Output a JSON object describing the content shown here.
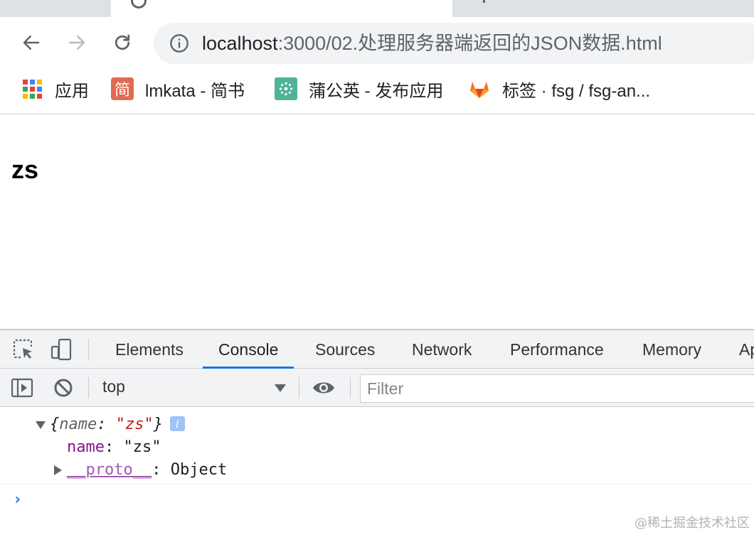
{
  "browser": {
    "address": {
      "host": "localhost",
      "path": ":3000/02.处理服务器端返回的JSON数据.html"
    },
    "bookmarks": [
      {
        "label": "应用",
        "icon": "apps-grid-icon"
      },
      {
        "label": "lmkata - 简书",
        "icon": "jianshu-icon",
        "icon_text": "简"
      },
      {
        "label": "蒲公英 - 发布应用",
        "icon": "pugongying-icon"
      },
      {
        "label": "标签 · fsg / fsg-an...",
        "icon": "gitlab-icon"
      }
    ]
  },
  "page": {
    "heading": "zs"
  },
  "devtools": {
    "tabs": [
      "Elements",
      "Console",
      "Sources",
      "Network",
      "Performance",
      "Memory",
      "Ap"
    ],
    "active_tab": "Console",
    "context": "top",
    "filter_placeholder": "Filter",
    "console": {
      "object_open": "{",
      "object_key": "name",
      "object_sep": ": ",
      "object_value": "\"zs\"",
      "object_close": "}",
      "prop_key": "name",
      "prop_sep": ": ",
      "prop_value": "\"zs\"",
      "proto_key": "__proto__",
      "proto_sep": ": ",
      "proto_value": "Object",
      "info_badge": "i",
      "prompt": "›"
    }
  },
  "watermark": "@稀土掘金技术社区",
  "colors": {
    "accent": "#1a73e8",
    "string": "#c41a16",
    "key": "#881391"
  }
}
